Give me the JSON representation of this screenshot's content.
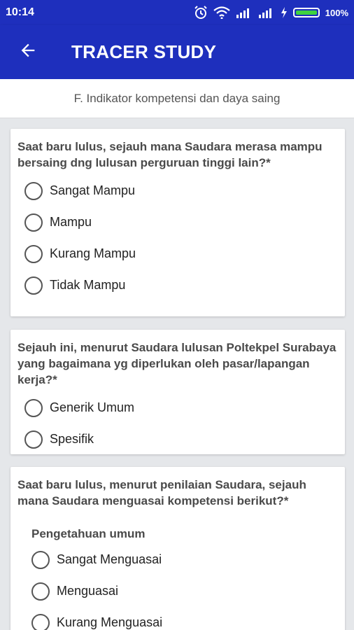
{
  "status_bar": {
    "time": "10:14",
    "battery_percent": "100%",
    "battery_level": 1.0,
    "icons": [
      "alarm-icon",
      "wifi-icon",
      "signal-icon",
      "signal-icon",
      "charging-icon",
      "battery-icon"
    ]
  },
  "app_bar": {
    "title": "TRACER STUDY",
    "back_icon": "arrow-left-icon",
    "color": "#1e2fbd"
  },
  "section": {
    "title": "F. Indikator kompetensi dan daya saing"
  },
  "questions": [
    {
      "text": "Saat baru lulus, sejauh mana Saudara merasa mampu bersaing dng lulusan perguruan tinggi lain?*",
      "options": [
        "Sangat Mampu",
        "Mampu",
        "Kurang Mampu",
        "Tidak Mampu"
      ]
    },
    {
      "text": "Sejauh ini, menurut Saudara lulusan Poltekpel Surabaya yang bagaimana yg diperlukan oleh pasar/lapangan kerja?*",
      "options": [
        "Generik Umum",
        "Spesifik"
      ]
    },
    {
      "text": "Saat baru lulus, menurut penilaian Saudara, sejauh mana Saudara menguasai kompetensi berikut?*",
      "subheading": "Pengetahuan umum",
      "options": [
        "Sangat Menguasai",
        "Menguasai",
        "Kurang Menguasai"
      ]
    }
  ]
}
